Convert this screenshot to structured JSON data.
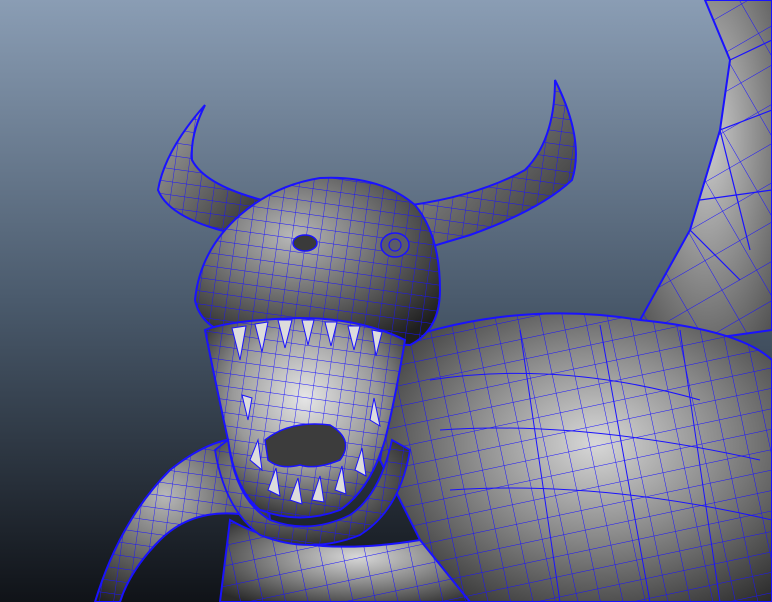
{
  "viewport": {
    "view_mode": "smooth-shaded-with-wireframe-on-shaded",
    "background_gradient": [
      "#8a9db4",
      "#41505f",
      "#101318"
    ],
    "wireframe_color": "#1a12ff",
    "surface_color_light": "#c9c9c9",
    "surface_color_dark": "#2b2b2b",
    "subject": "dragon-head-mesh"
  }
}
